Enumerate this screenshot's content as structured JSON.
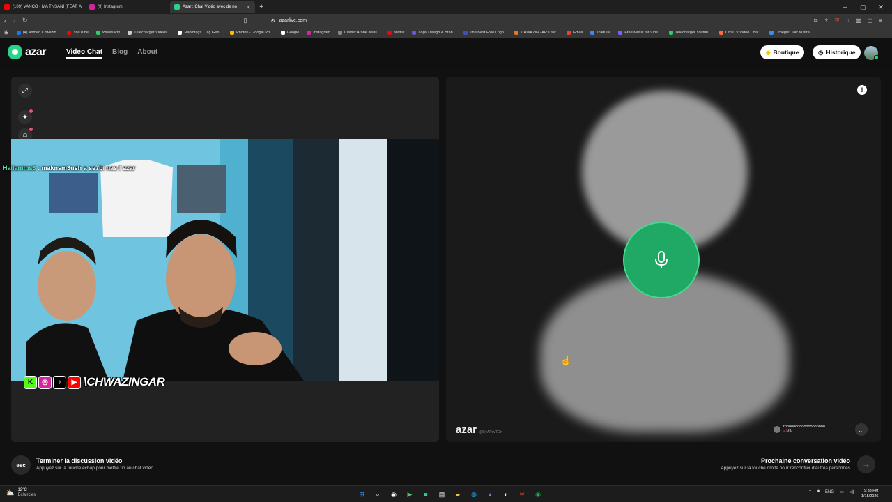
{
  "browser": {
    "tabs": [
      {
        "title": "(109) VANCO - MA TNSANI (FEAT. A",
        "color": "#ff0000",
        "active": false
      },
      {
        "title": "(9) Instagram",
        "color": "#d6249f",
        "active": false
      },
      {
        "title": "Azar : Chat Vidéo avec de no",
        "color": "#2ad38b",
        "active": true
      }
    ],
    "url": "azarlive.com",
    "bookmarks": [
      {
        "label": "(4) Ahmed Chwazin...",
        "color": "#1877f2"
      },
      {
        "label": "YouTube",
        "color": "#ff0000"
      },
      {
        "label": "WhatsApp",
        "color": "#25d366"
      },
      {
        "label": "Télécharger Vidéos...",
        "color": "#cccccc"
      },
      {
        "label": "Rapidtags | Tag Gen...",
        "color": "#ffffff"
      },
      {
        "label": "Photos - Google Ph...",
        "color": "#fbbc04"
      },
      {
        "label": "Google",
        "color": "#ffffff"
      },
      {
        "label": "Instagram",
        "color": "#d6249f"
      },
      {
        "label": "Clavier Arabe 3000...",
        "color": "#888888"
      },
      {
        "label": "Netflix",
        "color": "#e50914"
      },
      {
        "label": "Logo Design & Bran...",
        "color": "#6a5acd"
      },
      {
        "label": "The Best Free Logo...",
        "color": "#3f51b5"
      },
      {
        "label": "CHWAZINGAR's fav...",
        "color": "#e8742a"
      },
      {
        "label": "Gmail",
        "color": "#ea4335"
      },
      {
        "label": "Traduire",
        "color": "#4285f4"
      },
      {
        "label": "Free Music for Vide...",
        "color": "#7b61ff"
      },
      {
        "label": "Télécharger Youtub...",
        "color": "#2ecc71"
      },
      {
        "label": "OmeTV Video Chat...",
        "color": "#ff6b3d"
      },
      {
        "label": "Omegle: Talk to stra...",
        "color": "#3b8ef0"
      }
    ]
  },
  "header": {
    "logo": "azar",
    "nav": {
      "video_chat": "Video Chat",
      "blog": "Blog",
      "about": "About"
    },
    "shop_button": "Boutique",
    "history_button": "Historique"
  },
  "left": {
    "chat": {
      "user": "Hallanims3",
      "message": ": maknsm3ush a se7bi nas f azar"
    },
    "overlay_handle": "\\CHWAZINGAR"
  },
  "right": {
    "watermark": "azar",
    "watermark_id": "@EyAPdvTGn",
    "peer_name": "rooooooooooooooooooo",
    "peer_country": "MA"
  },
  "bottom": {
    "esc_key": "esc",
    "end_title": "Terminer la discussion vidéo",
    "end_sub": "Appuyez sur la touche échap pour mettre fin au chat vidéo.",
    "next_title": "Prochaine conversation vidéo",
    "next_sub": "Appuyez sur la touche droite pour rencontrer d'autres personnes"
  },
  "taskbar": {
    "temp": "12°C",
    "weather": "Éclaircies",
    "lang": "ENG",
    "time": "9:33 PM",
    "date": "1/15/2026"
  },
  "colors": {
    "accent": "#2ad38b",
    "mic": "#1fa964"
  }
}
